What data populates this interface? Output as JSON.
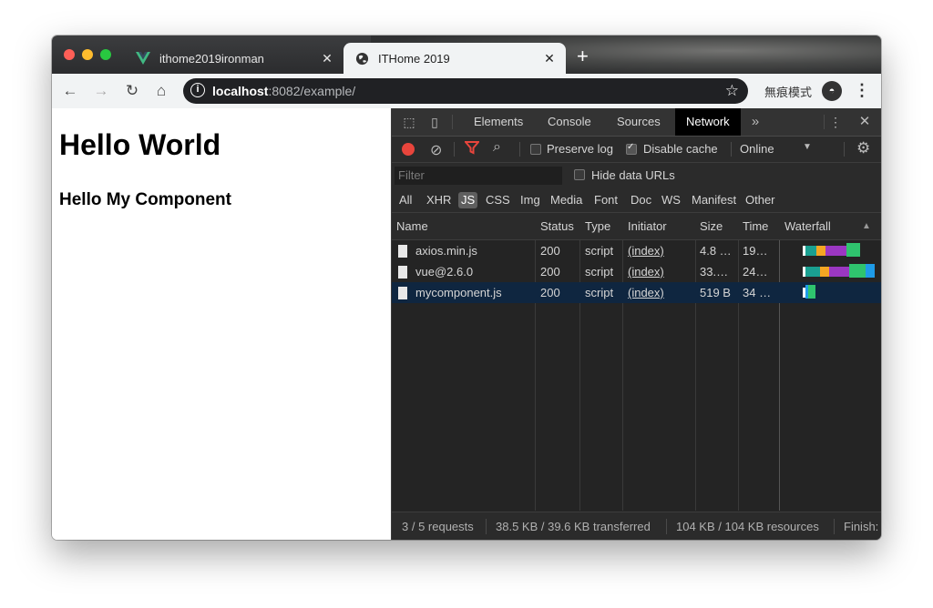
{
  "tabs": [
    {
      "title": "ithome2019ironman",
      "active": false,
      "favicon": "vue-logo-icon"
    },
    {
      "title": "ITHome 2019",
      "active": true,
      "favicon": "globe-icon"
    }
  ],
  "toolbar": {
    "url_host": "localhost",
    "url_rest": ":8082/example/",
    "incognito_label": "無痕模式"
  },
  "page": {
    "heading1": "Hello World",
    "heading2": "Hello My Component"
  },
  "devtools": {
    "panels": [
      "Elements",
      "Console",
      "Sources",
      "Network"
    ],
    "active_panel": "Network",
    "preserve_log": "Preserve log",
    "disable_cache": "Disable cache",
    "throttle": "Online",
    "filter_placeholder": "Filter",
    "hide_data_urls": "Hide data URLs",
    "types": [
      "All",
      "XHR",
      "JS",
      "CSS",
      "Img",
      "Media",
      "Font",
      "Doc",
      "WS",
      "Manifest",
      "Other"
    ],
    "selected_type": "JS",
    "columns": [
      "Name",
      "Status",
      "Type",
      "Initiator",
      "Size",
      "Time",
      "Waterfall"
    ],
    "rows": [
      {
        "name": "axios.min.js",
        "status": "200",
        "type": "script",
        "initiator": "(index)",
        "size": "4.8 …",
        "time": "19…"
      },
      {
        "name": "vue@2.6.0",
        "status": "200",
        "type": "script",
        "initiator": "(index)",
        "size": "33.…",
        "time": "24…"
      },
      {
        "name": "mycomponent.js",
        "status": "200",
        "type": "script",
        "initiator": "(index)",
        "size": "519 B",
        "time": "34 …"
      }
    ],
    "status": {
      "requests": "3 / 5 requests",
      "transferred": "38.5 KB / 39.6 KB transferred",
      "resources": "104 KB / 104 KB resources",
      "finish": "Finish:"
    }
  }
}
